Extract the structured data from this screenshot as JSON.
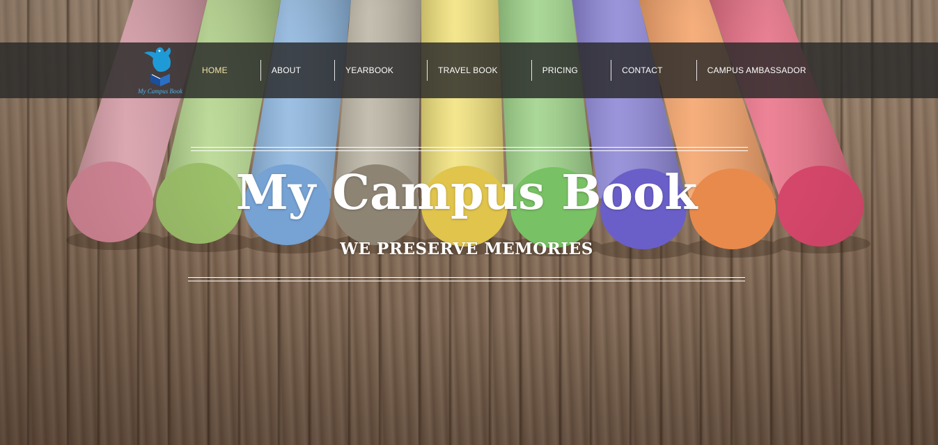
{
  "site": {
    "logo_text": "My Campus Book"
  },
  "nav": {
    "items": [
      {
        "label": "HOME",
        "active": true
      },
      {
        "label": "ABOUT",
        "active": false
      },
      {
        "label": "YEARBOOK",
        "active": false
      },
      {
        "label": "TRAVEL BOOK",
        "active": false
      },
      {
        "label": "PRICING",
        "active": false
      },
      {
        "label": "CONTACT",
        "active": false
      },
      {
        "label": "CAMPUS AMBASSADOR",
        "active": false
      }
    ]
  },
  "hero": {
    "title": "My Campus Book",
    "subtitle": "WE PRESERVE MEMORIES"
  },
  "colors": {
    "nav_active": "#f2e3a6",
    "nav_text": "#ffffff",
    "logo_accent": "#1e9bd7"
  }
}
